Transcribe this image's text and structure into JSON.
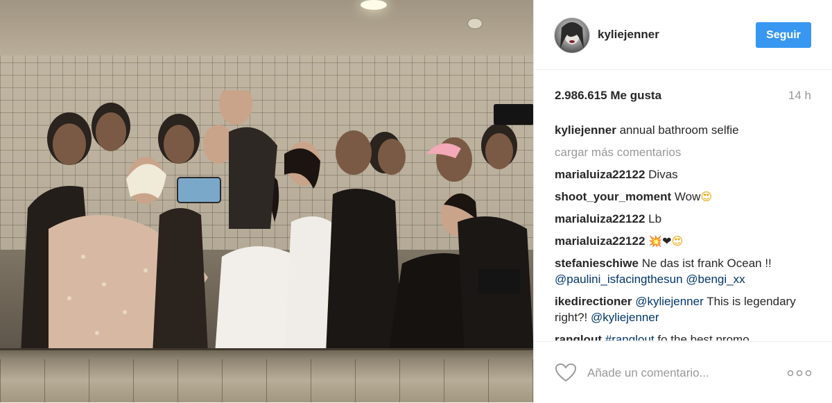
{
  "post": {
    "username": "kyliejenner",
    "follow_label": "Seguir",
    "likes": "2.986.615 Me gusta",
    "time": "14 h",
    "caption": {
      "user": "kyliejenner",
      "text": "annual bathroom selfie"
    },
    "load_more": "cargar más comentarios",
    "comments": [
      {
        "user": "marialuiza22122",
        "text": "Divas"
      },
      {
        "user": "shoot_your_moment",
        "text": "Wow",
        "emoji": "😍"
      },
      {
        "user": "marialuiza22122",
        "text": "Lb"
      },
      {
        "user": "marialuiza22122",
        "emoji1": "💥",
        "emoji2": "❤",
        "emoji3": "😍"
      },
      {
        "user": "stefanieschiwe",
        "text": "Ne das ist frank Ocean !!",
        "mention1": "@paulini_isfacingthesun",
        "mention2": "@bengi_xx"
      },
      {
        "user": "ikedirectioner",
        "mention1": "@kyliejenner",
        "text": "This is legendary right?!",
        "mention2": "@kyliejenner"
      },
      {
        "user": "ranglout",
        "mention1": "#ranglout",
        "text": "fo the best promo"
      }
    ],
    "add_comment_placeholder": "Añade un comentario...",
    "icons": {
      "like": "heart-outline-icon",
      "more": "more-options-icon"
    },
    "colors": {
      "accent": "#3897f0",
      "mention": "#003569",
      "muted": "#999999"
    }
  }
}
